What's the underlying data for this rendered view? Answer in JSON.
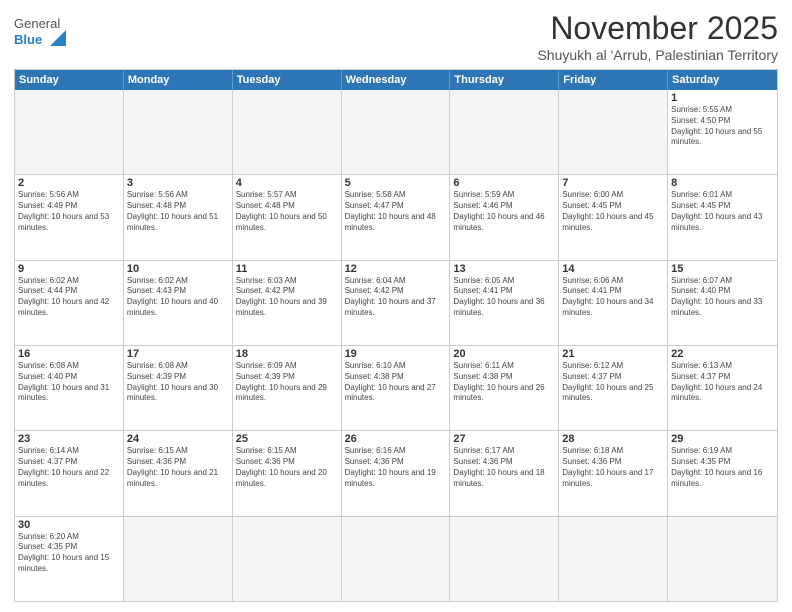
{
  "header": {
    "logo_general": "General",
    "logo_blue": "Blue",
    "month_title": "November 2025",
    "location": "Shuyukh al 'Arrub, Palestinian Territory"
  },
  "weekdays": [
    "Sunday",
    "Monday",
    "Tuesday",
    "Wednesday",
    "Thursday",
    "Friday",
    "Saturday"
  ],
  "rows": [
    {
      "cells": [
        {
          "day": "",
          "info": "",
          "empty": true
        },
        {
          "day": "",
          "info": "",
          "empty": true
        },
        {
          "day": "",
          "info": "",
          "empty": true
        },
        {
          "day": "",
          "info": "",
          "empty": true
        },
        {
          "day": "",
          "info": "",
          "empty": true
        },
        {
          "day": "",
          "info": "",
          "empty": true
        },
        {
          "day": "1",
          "info": "Sunrise: 5:55 AM\nSunset: 4:50 PM\nDaylight: 10 hours and 55 minutes."
        }
      ]
    },
    {
      "cells": [
        {
          "day": "2",
          "info": "Sunrise: 5:56 AM\nSunset: 4:49 PM\nDaylight: 10 hours and 53 minutes."
        },
        {
          "day": "3",
          "info": "Sunrise: 5:56 AM\nSunset: 4:48 PM\nDaylight: 10 hours and 51 minutes."
        },
        {
          "day": "4",
          "info": "Sunrise: 5:57 AM\nSunset: 4:48 PM\nDaylight: 10 hours and 50 minutes."
        },
        {
          "day": "5",
          "info": "Sunrise: 5:58 AM\nSunset: 4:47 PM\nDaylight: 10 hours and 48 minutes."
        },
        {
          "day": "6",
          "info": "Sunrise: 5:59 AM\nSunset: 4:46 PM\nDaylight: 10 hours and 46 minutes."
        },
        {
          "day": "7",
          "info": "Sunrise: 6:00 AM\nSunset: 4:45 PM\nDaylight: 10 hours and 45 minutes."
        },
        {
          "day": "8",
          "info": "Sunrise: 6:01 AM\nSunset: 4:45 PM\nDaylight: 10 hours and 43 minutes."
        }
      ]
    },
    {
      "cells": [
        {
          "day": "9",
          "info": "Sunrise: 6:02 AM\nSunset: 4:44 PM\nDaylight: 10 hours and 42 minutes."
        },
        {
          "day": "10",
          "info": "Sunrise: 6:02 AM\nSunset: 4:43 PM\nDaylight: 10 hours and 40 minutes."
        },
        {
          "day": "11",
          "info": "Sunrise: 6:03 AM\nSunset: 4:42 PM\nDaylight: 10 hours and 39 minutes."
        },
        {
          "day": "12",
          "info": "Sunrise: 6:04 AM\nSunset: 4:42 PM\nDaylight: 10 hours and 37 minutes."
        },
        {
          "day": "13",
          "info": "Sunrise: 6:05 AM\nSunset: 4:41 PM\nDaylight: 10 hours and 36 minutes."
        },
        {
          "day": "14",
          "info": "Sunrise: 6:06 AM\nSunset: 4:41 PM\nDaylight: 10 hours and 34 minutes."
        },
        {
          "day": "15",
          "info": "Sunrise: 6:07 AM\nSunset: 4:40 PM\nDaylight: 10 hours and 33 minutes."
        }
      ]
    },
    {
      "cells": [
        {
          "day": "16",
          "info": "Sunrise: 6:08 AM\nSunset: 4:40 PM\nDaylight: 10 hours and 31 minutes."
        },
        {
          "day": "17",
          "info": "Sunrise: 6:08 AM\nSunset: 4:39 PM\nDaylight: 10 hours and 30 minutes."
        },
        {
          "day": "18",
          "info": "Sunrise: 6:09 AM\nSunset: 4:39 PM\nDaylight: 10 hours and 29 minutes."
        },
        {
          "day": "19",
          "info": "Sunrise: 6:10 AM\nSunset: 4:38 PM\nDaylight: 10 hours and 27 minutes."
        },
        {
          "day": "20",
          "info": "Sunrise: 6:11 AM\nSunset: 4:38 PM\nDaylight: 10 hours and 26 minutes."
        },
        {
          "day": "21",
          "info": "Sunrise: 6:12 AM\nSunset: 4:37 PM\nDaylight: 10 hours and 25 minutes."
        },
        {
          "day": "22",
          "info": "Sunrise: 6:13 AM\nSunset: 4:37 PM\nDaylight: 10 hours and 24 minutes."
        }
      ]
    },
    {
      "cells": [
        {
          "day": "23",
          "info": "Sunrise: 6:14 AM\nSunset: 4:37 PM\nDaylight: 10 hours and 22 minutes."
        },
        {
          "day": "24",
          "info": "Sunrise: 6:15 AM\nSunset: 4:36 PM\nDaylight: 10 hours and 21 minutes."
        },
        {
          "day": "25",
          "info": "Sunrise: 6:15 AM\nSunset: 4:36 PM\nDaylight: 10 hours and 20 minutes."
        },
        {
          "day": "26",
          "info": "Sunrise: 6:16 AM\nSunset: 4:36 PM\nDaylight: 10 hours and 19 minutes."
        },
        {
          "day": "27",
          "info": "Sunrise: 6:17 AM\nSunset: 4:36 PM\nDaylight: 10 hours and 18 minutes."
        },
        {
          "day": "28",
          "info": "Sunrise: 6:18 AM\nSunset: 4:36 PM\nDaylight: 10 hours and 17 minutes."
        },
        {
          "day": "29",
          "info": "Sunrise: 6:19 AM\nSunset: 4:35 PM\nDaylight: 10 hours and 16 minutes."
        }
      ]
    },
    {
      "cells": [
        {
          "day": "30",
          "info": "Sunrise: 6:20 AM\nSunset: 4:35 PM\nDaylight: 10 hours and 15 minutes."
        },
        {
          "day": "",
          "info": "",
          "empty": true
        },
        {
          "day": "",
          "info": "",
          "empty": true
        },
        {
          "day": "",
          "info": "",
          "empty": true
        },
        {
          "day": "",
          "info": "",
          "empty": true
        },
        {
          "day": "",
          "info": "",
          "empty": true
        },
        {
          "day": "",
          "info": "",
          "empty": true
        }
      ]
    }
  ]
}
